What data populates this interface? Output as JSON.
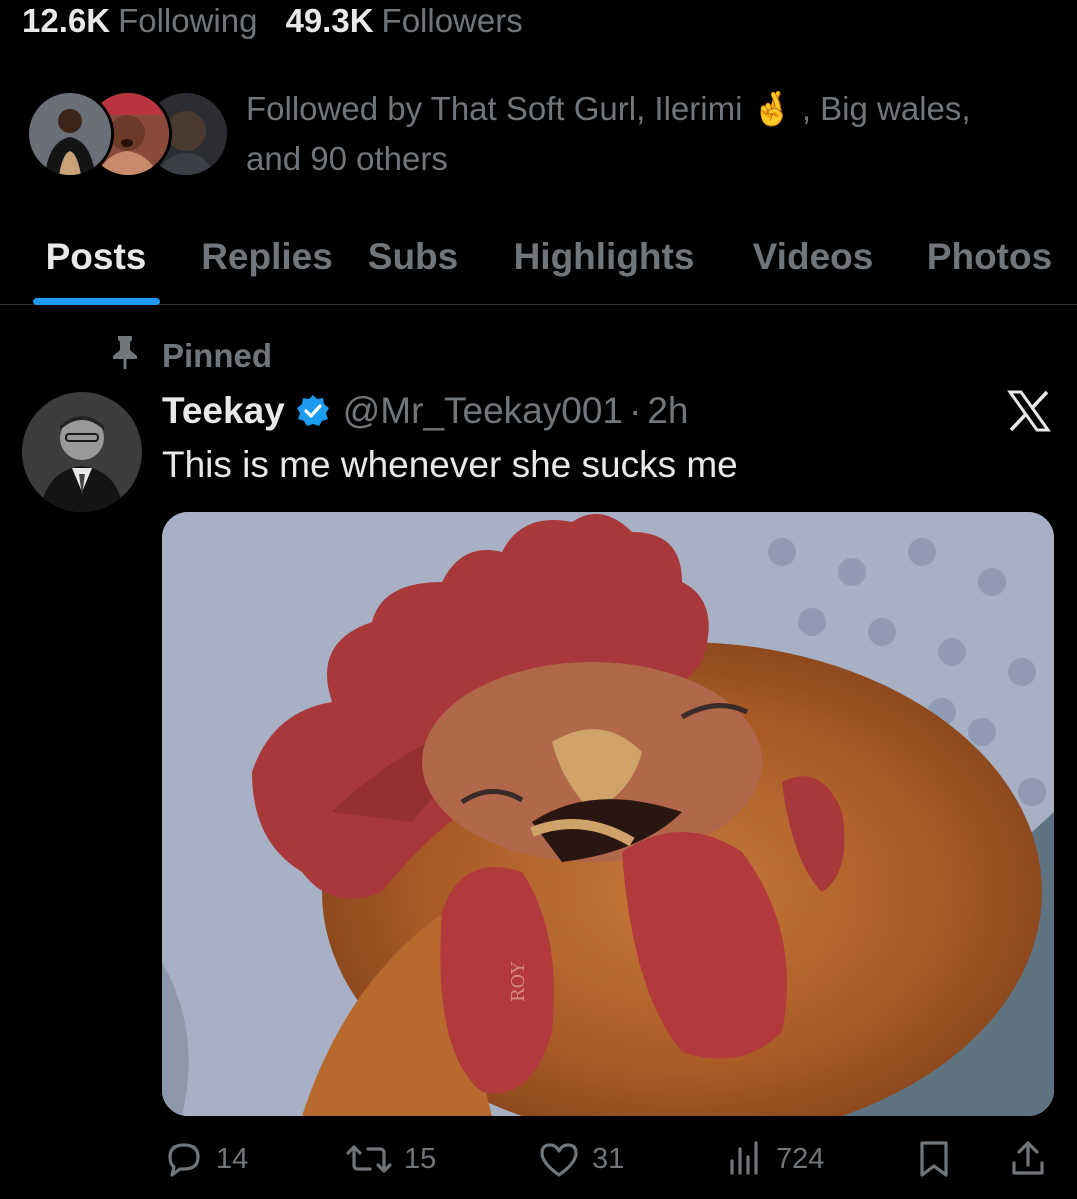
{
  "profile": {
    "following_count": "12.6K",
    "following_label": "Following",
    "followers_count": "49.3K",
    "followers_label": "Followers",
    "followed_by_line1": "Followed by That Soft Gurl, Ilerimi 🤞 , Big wales,",
    "followed_by_line2": "and 90 others"
  },
  "tabs": [
    {
      "label": "Posts",
      "active": true
    },
    {
      "label": "Replies",
      "active": false
    },
    {
      "label": "Subs",
      "active": false
    },
    {
      "label": "Highlights",
      "active": false
    },
    {
      "label": "Videos",
      "active": false
    },
    {
      "label": "Photos",
      "active": false
    }
  ],
  "post": {
    "pinned_label": "Pinned",
    "author": "Teekay",
    "handle": "@Mr_Teekay001",
    "separator": "·",
    "time": "2h",
    "text": "This is me whenever she sucks me",
    "media_watermark": "ROY",
    "stats": {
      "replies": "14",
      "reposts": "15",
      "likes": "31",
      "views": "724"
    }
  },
  "icons": {
    "pin": "pin-icon",
    "verified": "verified-badge-icon",
    "x_logo": "x-logo-icon",
    "reply": "reply-icon",
    "repost": "repost-icon",
    "like": "heart-icon",
    "views": "views-icon",
    "bookmark": "bookmark-icon",
    "share": "share-icon"
  },
  "colors": {
    "background": "#000000",
    "text_primary": "#e7e9ea",
    "text_secondary": "#71767b",
    "accent": "#1d9bf0",
    "divider": "#2f3336"
  }
}
